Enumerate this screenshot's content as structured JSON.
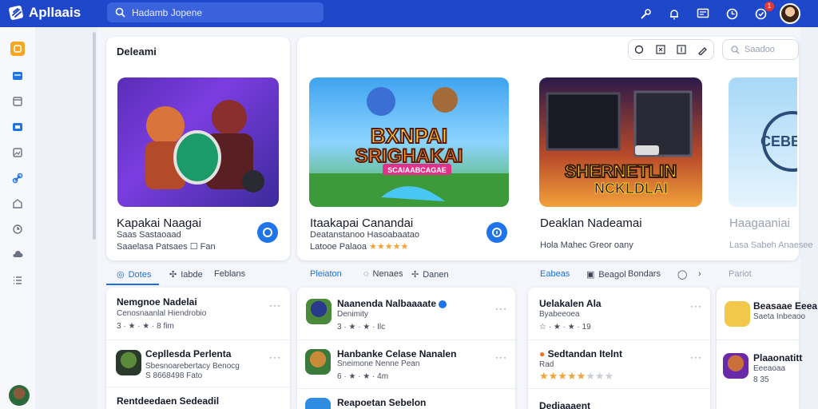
{
  "app": {
    "name": "Apllaais"
  },
  "search": {
    "placeholder": "Hadamb Jopene"
  },
  "topbar": {
    "notification_count": "1"
  },
  "panel": {
    "title": "Deleami"
  },
  "search_small": {
    "placeholder": "Saadoo"
  },
  "featured": [
    {
      "title": "Kapakai Naagai",
      "sub1": "Saas Sastaoaad",
      "sub2": "Saaelasa Patsaes  ☐  Fan"
    },
    {
      "title": "Itaakapai Canandai",
      "sub1": "Deatanstanoo Hasoabaatao",
      "sub2": "Latooe Palaoa"
    },
    {
      "title": "Deaklan Nadeamai",
      "sub1": "Hola Mahec  Greor oany",
      "sub2": ""
    },
    {
      "title": "Haagaaniai",
      "sub1": "Lasa Sabeh Anaesee",
      "sub2": ""
    }
  ],
  "banner_text": [
    {
      "line1": "BXNPAI",
      "line2": "SRIGHAKAI",
      "line3": "SCAIAABCAGAE"
    },
    {
      "line1": "SHERNETLIN",
      "line2": "NCKLDLAI"
    },
    {
      "line1": "CEBBR"
    }
  ],
  "tabs": [
    {
      "label": "Dotes"
    },
    {
      "label": "Iabde"
    },
    {
      "label": "Feblans"
    },
    {
      "label": "Pleiaton"
    },
    {
      "label": "Nenaes"
    },
    {
      "label": "Danen"
    },
    {
      "label": "Eabeas"
    },
    {
      "label": "Beagol"
    },
    {
      "label": "Bondars"
    },
    {
      "label": "Pariot"
    }
  ],
  "lists": [
    [
      {
        "title": "Nemgnoe Nadelai",
        "sub": "Cenosnaanlal Hiendrobio",
        "rating": "3 · ★ · ★ ·  8 fim"
      },
      {
        "title": "Cepllesda Perlenta",
        "sub": "Sbesnoarebertacy Benocg",
        "rating": "S 8668498 Fato"
      },
      {
        "title": "Rentdeedaen Sedeadil",
        "sub": "",
        "rating": ""
      }
    ],
    [
      {
        "title": "Naanenda Nalbaaaate",
        "sub": "Denimity",
        "rating": "3 · ★ · ★ ·  Ilc"
      },
      {
        "title": "Hanbanke Celase Nanalen",
        "sub": "Sneimone Nenne Pean",
        "rating": "6 · ★ · ★ ·  4m"
      },
      {
        "title": "Reapoetan Sebelon",
        "sub": "",
        "rating": ""
      }
    ],
    [
      {
        "title": "Uelakalen Ala",
        "sub": "Byabeeoea",
        "rating": "☆ · ★ · ★ ·  19"
      },
      {
        "title": "Sedtandan  Itelnt",
        "sub": "Rad",
        "rating": ""
      },
      {
        "title": "Dediaaaent",
        "sub": "",
        "rating": ""
      }
    ],
    [
      {
        "title": "Beasaae Eeea",
        "sub": "Saeta Inbeaoo",
        "rating": ""
      },
      {
        "title": "Plaaonatitt",
        "sub": "Eeeaoaa",
        "rating": "8 35"
      }
    ]
  ],
  "colors": {
    "brand": "#1f47c9",
    "accent": "#1e74e8",
    "star": "#f2a23a"
  }
}
